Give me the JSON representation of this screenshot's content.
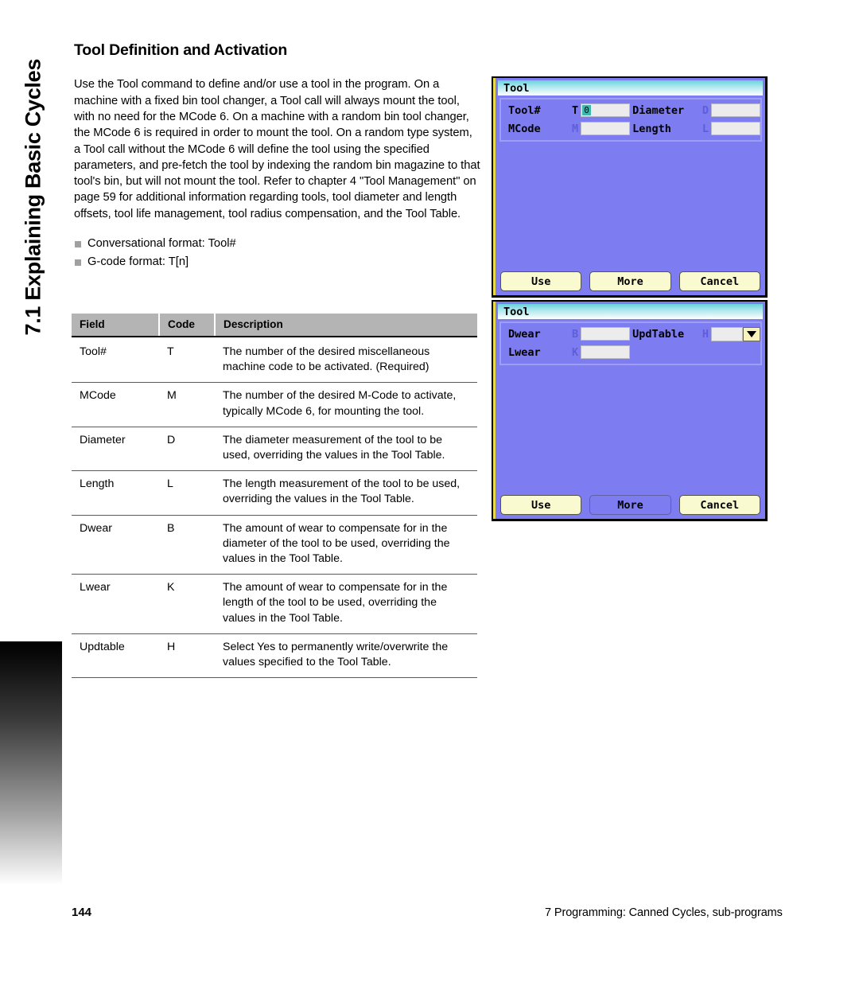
{
  "sidebar": {
    "chapter_label": "7.1 Explaining Basic Cycles"
  },
  "page": {
    "title": "Tool Definition and Activation",
    "body_paragraph": "Use the Tool command to define and/or use a tool in the program. On a machine with a fixed bin tool changer, a Tool call will always mount the tool, with no need for the MCode 6. On a machine with a random bin tool changer, the MCode 6 is required in order to mount the tool. On a random type system, a Tool call without the MCode 6 will define the tool using the specified parameters, and pre-fetch the tool by indexing the random bin magazine to that tool's bin, but will not mount the tool. Refer to chapter 4 \"Tool Management\" on page 59 for additional information regarding tools, tool diameter and length offsets, tool life management, tool radius compensation, and the Tool Table.",
    "bullets": [
      "Conversational format: Tool#",
      "G-code format: T[n]"
    ]
  },
  "table": {
    "headers": [
      "Field",
      "Code",
      "Description"
    ],
    "rows": [
      {
        "field": "Tool#",
        "code": "T",
        "description": "The number of the desired miscellaneous machine code to be activated. (Required)"
      },
      {
        "field": "MCode",
        "code": "M",
        "description": "The number of the desired M-Code to activate, typically MCode 6, for mounting the tool."
      },
      {
        "field": "Diameter",
        "code": "D",
        "description": "The diameter measurement of the tool to be used, overriding the values in the Tool Table."
      },
      {
        "field": "Length",
        "code": "L",
        "description": "The length measurement of the tool to be used, overriding the values in the Tool Table."
      },
      {
        "field": "Dwear",
        "code": "B",
        "description": "The amount of wear to compensate for in the diameter of the tool to be used, overriding the values in the Tool Table."
      },
      {
        "field": "Lwear",
        "code": "K",
        "description": "The amount of wear to compensate for in the length of the tool to be used, overriding the values in the Tool Table."
      },
      {
        "field": "Updtable",
        "code": "H",
        "description": "Select Yes to permanently write/overwrite the values specified to the Tool Table."
      }
    ]
  },
  "screenshot_page1": {
    "title": "Tool",
    "fields": {
      "tool_num_label": "Tool#",
      "tool_num_code": "T",
      "tool_num_value": "0",
      "mcode_label": "MCode",
      "mcode_code": "M",
      "mcode_value": "",
      "diameter_label": "Diameter",
      "diameter_code": "D",
      "diameter_value": "",
      "length_label": "Length",
      "length_code": "L",
      "length_value": ""
    },
    "buttons": [
      "Use",
      "More",
      "Cancel"
    ]
  },
  "screenshot_page2": {
    "title": "Tool",
    "fields": {
      "dwear_label": "Dwear",
      "dwear_code": "B",
      "dwear_value": "",
      "lwear_label": "Lwear",
      "lwear_code": "K",
      "lwear_value": "",
      "updtable_label": "UpdTable",
      "updtable_code": "H",
      "updtable_value": ""
    },
    "buttons": [
      "Use",
      "More",
      "Cancel"
    ]
  },
  "footer": {
    "page_number": "144",
    "chapter_note": "7 Programming: Canned Cycles, sub-programs"
  },
  "colors": {
    "dialog_background": "#7d7cf0",
    "titlebar_accent": "#66d2dc",
    "button_fill": "#fafad0",
    "left_strip": "#e8d84a",
    "table_header": "#b4b4b4",
    "bullet": "#a0a0a0"
  }
}
